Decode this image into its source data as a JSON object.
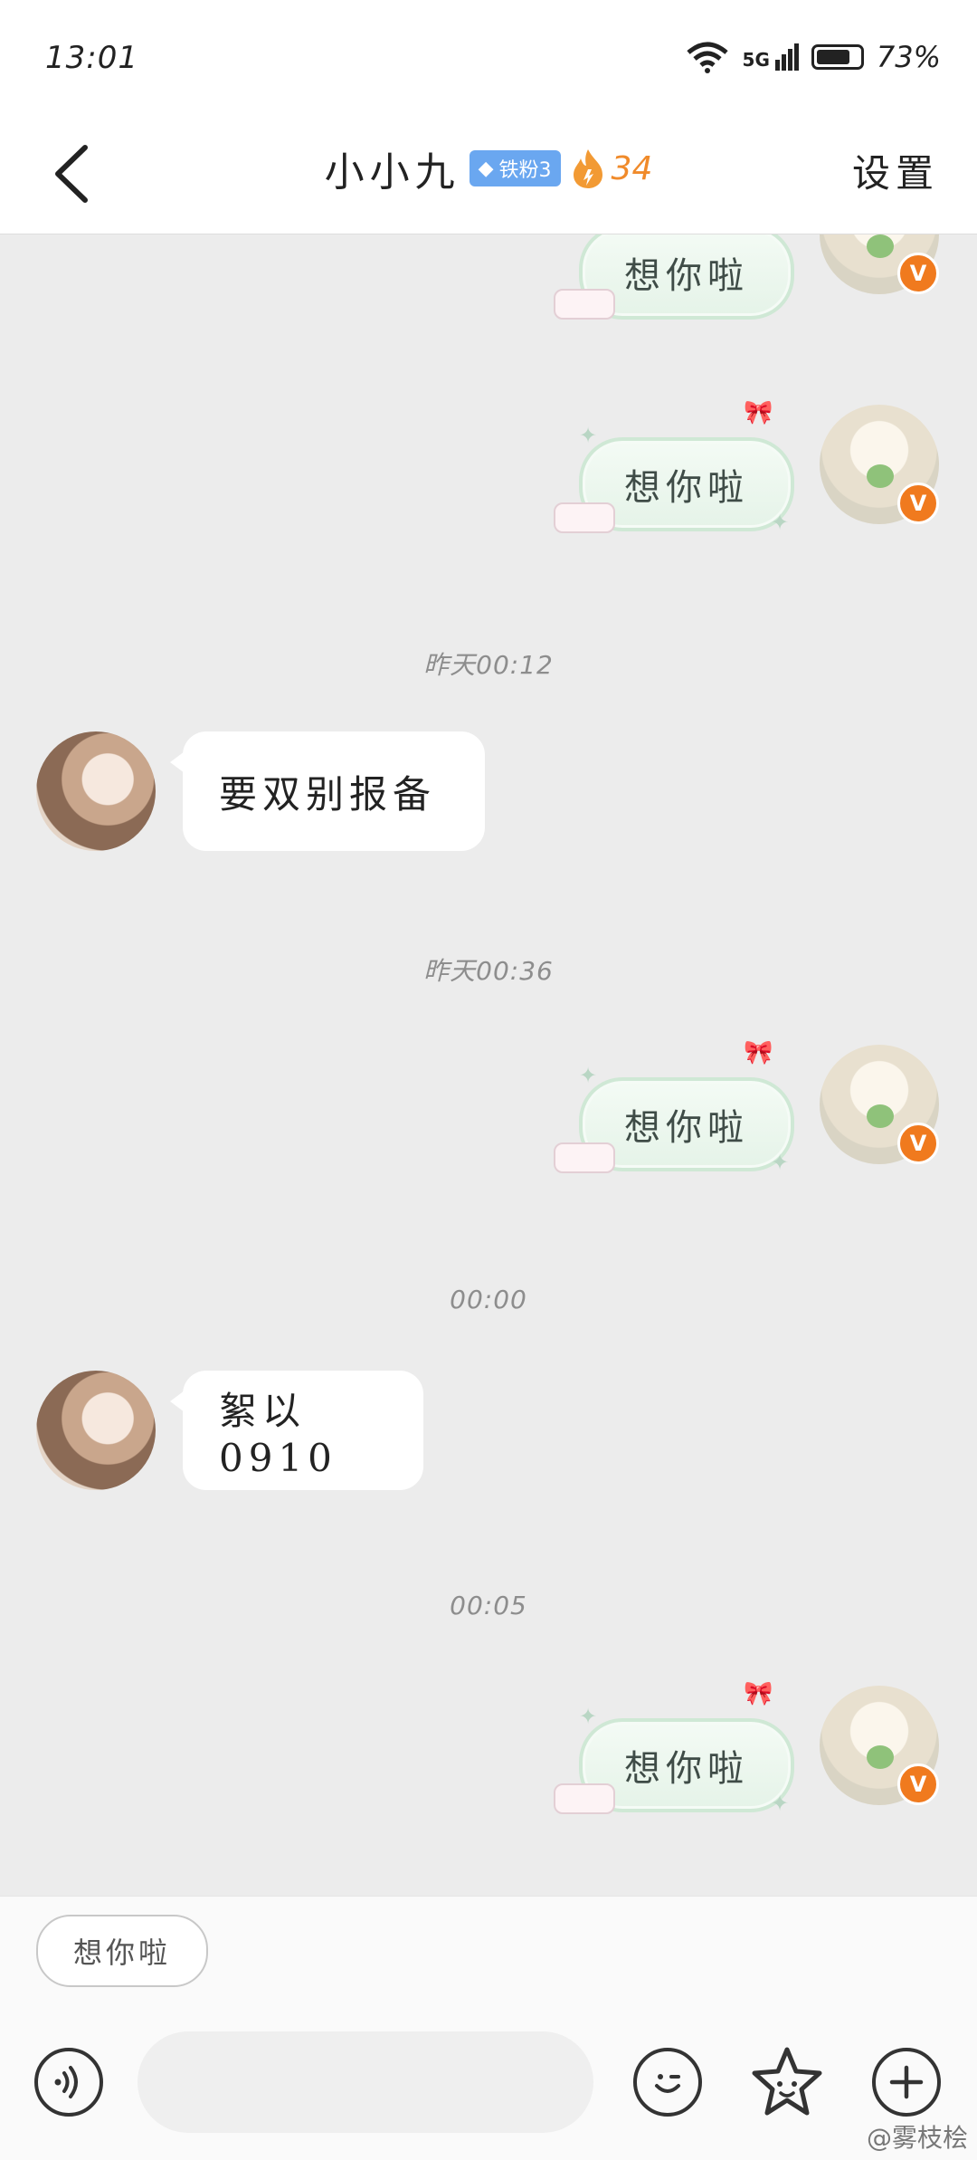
{
  "status_bar": {
    "time": "13:01",
    "battery": "73%",
    "network": "5G",
    "wifi_badge": "6"
  },
  "header": {
    "back_label": "<",
    "title": "小小九",
    "fan_badge": "铁粉3",
    "fire_count": "34",
    "settings_label": "设置"
  },
  "messages": [
    {
      "side": "me",
      "type": "sticker",
      "text": "想你啦"
    },
    {
      "side": "me",
      "type": "sticker",
      "text": "想你啦"
    },
    {
      "type": "timestamp",
      "text": "昨天00:12"
    },
    {
      "side": "other",
      "type": "text",
      "text": "要双别报备"
    },
    {
      "type": "timestamp",
      "text": "昨天00:36"
    },
    {
      "side": "me",
      "type": "sticker",
      "text": "想你啦"
    },
    {
      "type": "timestamp",
      "text": "00:00"
    },
    {
      "side": "other",
      "type": "text",
      "text": "絮以0910"
    },
    {
      "type": "timestamp",
      "text": "00:05"
    },
    {
      "side": "me",
      "type": "sticker",
      "text": "想你啦"
    }
  ],
  "quick_reply": {
    "chip": "想你啦"
  },
  "input": {
    "placeholder": ""
  },
  "icons": {
    "back": "chevron-left-icon",
    "fire": "fire-icon",
    "voice": "voice-icon",
    "emoji": "emoji-icon",
    "sticker": "sticker-icon",
    "add": "add-icon",
    "verified": "verified-badge-icon"
  },
  "verified_badge": "V",
  "watermark": "@雾枝桧",
  "colors": {
    "accent_orange": "#f07a1e",
    "badge_blue": "#6aa7f0",
    "chat_bg": "#ececec"
  }
}
